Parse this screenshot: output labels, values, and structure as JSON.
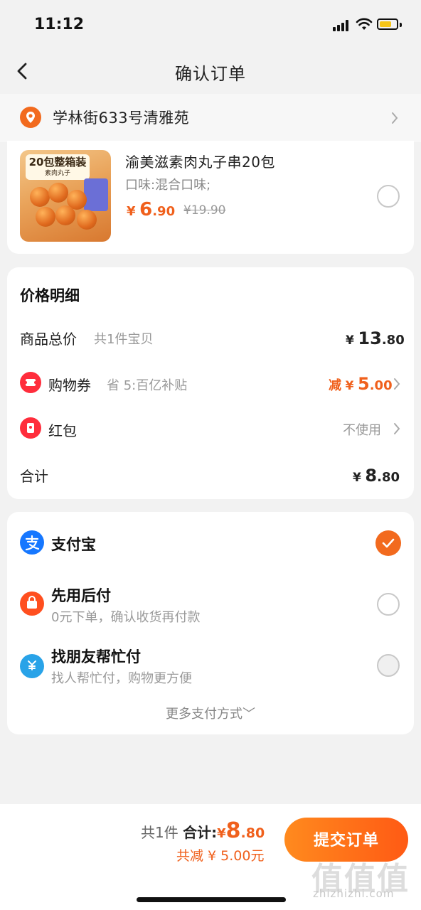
{
  "status": {
    "time": "11:12"
  },
  "nav": {
    "title": "确认订单"
  },
  "address": {
    "text": "学林街633号清雅苑"
  },
  "product": {
    "thumb_banner": "20包整箱装",
    "thumb_sub": "素肉丸子",
    "name": "渝美滋素肉丸子串20包",
    "flavor": "口味:混合口味;",
    "price_symbol": "¥",
    "price_int": "6",
    "price_dec": ".90",
    "orig_price": "¥19.90"
  },
  "price_detail": {
    "title": "价格明细",
    "goods_total_label": "商品总价",
    "goods_total_sub": "共1件宝贝",
    "goods_total_symbol": "¥",
    "goods_total_int": "13",
    "goods_total_dec": ".80",
    "coupon_label": "购物券",
    "coupon_sub": "省 5:百亿补贴",
    "coupon_prefix": "减",
    "coupon_symbol": "¥",
    "coupon_int": "5",
    "coupon_dec": ".00",
    "redpack_label": "红包",
    "redpack_value": "不使用",
    "total_label": "合计",
    "total_symbol": "¥",
    "total_int": "8",
    "total_dec": ".80"
  },
  "payment": {
    "alipay_label": "支付宝",
    "later_label": "先用后付",
    "later_sub": "0元下单，确认收货再付款",
    "friend_label": "找朋友帮忙付",
    "friend_sub": "找人帮忙付，购物更方便",
    "more": "更多支付方式"
  },
  "footer": {
    "count": "共1件",
    "total_label": "合计:",
    "total_symbol": "¥",
    "total_int": "8",
    "total_dec": ".80",
    "saved": "共减 ¥ 5.00元",
    "submit": "提交订单"
  },
  "watermark": {
    "logo": "值值值",
    "site": "zhizhizhi.com"
  },
  "colors": {
    "accent": "#f0601c",
    "alipay": "#1677ff",
    "red_icon": "#ff2d3c"
  }
}
